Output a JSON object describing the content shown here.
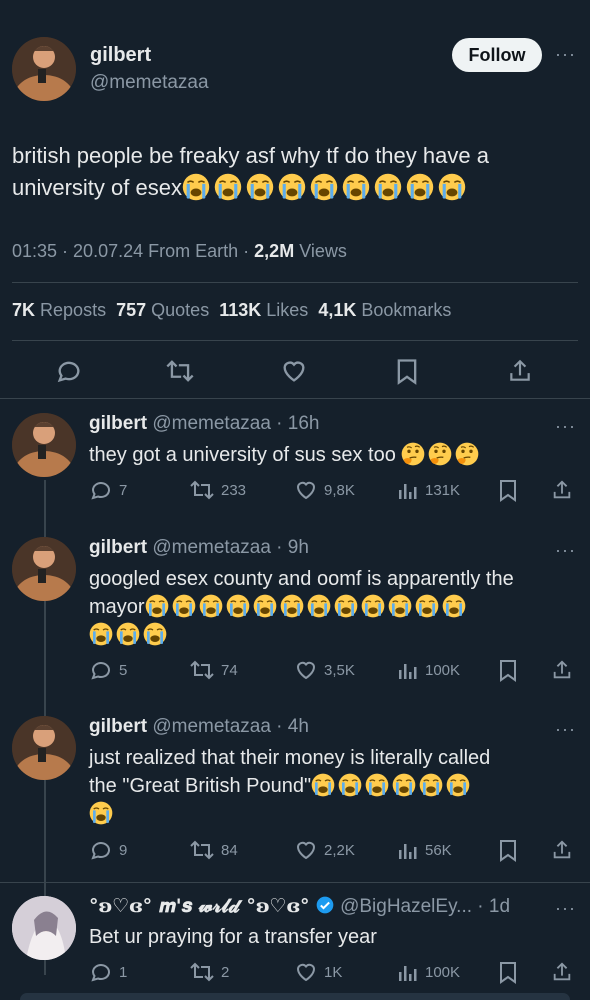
{
  "main_tweet": {
    "author_name": "gilbert",
    "handle": "@memetazaa",
    "follow_label": "Follow",
    "more_label": "···",
    "text": "british people be freaky asf why tf do they have a university of esex",
    "emoji_count": 9,
    "meta": {
      "time": "01:35",
      "date": "20.07.24",
      "source": "From Earth",
      "views_count": "2,2M",
      "views_label": "Views"
    },
    "stats": {
      "reposts_count": "7K",
      "reposts_label": "Reposts",
      "quotes_count": "757",
      "quotes_label": "Quotes",
      "likes_count": "113K",
      "likes_label": "Likes",
      "bookmarks_count": "4,1K",
      "bookmarks_label": "Bookmarks"
    }
  },
  "replies": [
    {
      "author_name": "gilbert",
      "handle_time": "@memetazaa · 16h",
      "text": "they got a university of sus sex too",
      "emoji": "thinking-face",
      "replies": "7",
      "reposts": "233",
      "likes": "9,8K",
      "views": "131K"
    },
    {
      "author_name": "gilbert",
      "handle_time": "@memetazaa · 9h",
      "text_line1": "googled esex county and oomf is apparently the",
      "text_line2": "mayor",
      "emoji": "loudly-crying-face",
      "replies": "5",
      "reposts": "74",
      "likes": "3,5K",
      "views": "100K"
    },
    {
      "author_name": "gilbert",
      "handle_time": "@memetazaa · 4h",
      "text_line1": "just realized that their money is literally called",
      "text_line2": "the \"Great British Pound\"",
      "emoji": "loudly-crying-face",
      "replies": "9",
      "reposts": "84",
      "likes": "2,2K",
      "views": "56K"
    },
    {
      "author_name": "°ʚ♡ɞ° 𝒎'𝒔 𝔀𝓻𝓵𝓭 °ʚ♡ɞ°",
      "handle_time": "@BigHazelEy... · 1d",
      "text": "Bet ur praying for a transfer year",
      "verified": true,
      "replies": "1",
      "reposts": "2",
      "likes": "1K",
      "views": "100K"
    }
  ],
  "colors": {
    "background": "#15202b",
    "muted": "#8b98a5",
    "divider": "#38444d",
    "verified": "#1d9bf0",
    "emoji": "#ffcc4d"
  }
}
